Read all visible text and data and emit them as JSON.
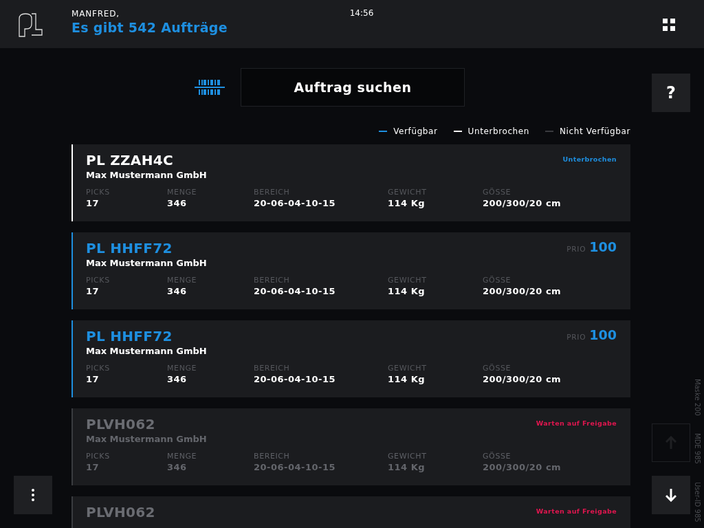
{
  "header": {
    "greeting": "MANFRED,",
    "title": "Es gibt 542 Aufträge",
    "time": "14:56"
  },
  "search": {
    "label": "Auftrag suchen"
  },
  "legend": [
    {
      "label": "Verfügbar",
      "color": "#1e8fe0"
    },
    {
      "label": "Unterbrochen",
      "color": "#ffffff"
    },
    {
      "label": "Nicht Verfügbar",
      "color": "#3a3b3f"
    }
  ],
  "orders": [
    {
      "kind": "interrupted",
      "title": "PL ZZAH4C",
      "company": "Max Mustermann GmbH",
      "status": "Unterbrochen",
      "fields": [
        {
          "label": "PICKS",
          "value": "17"
        },
        {
          "label": "MENGE",
          "value": "346"
        },
        {
          "label": "BEREICH",
          "value": "20-06-04-10-15"
        },
        {
          "label": "GEWICHT",
          "value": "114 Kg"
        },
        {
          "label": "GÖSSE",
          "value": "200/300/20 cm"
        }
      ]
    },
    {
      "kind": "available",
      "title": "PL HHFF72",
      "company": "Max Mustermann GmbH",
      "prio_label": "PRIO",
      "prio": "100",
      "fields": [
        {
          "label": "PICKS",
          "value": "17"
        },
        {
          "label": "MENGE",
          "value": "346"
        },
        {
          "label": "BEREICH",
          "value": "20-06-04-10-15"
        },
        {
          "label": "GEWICHT",
          "value": "114 Kg"
        },
        {
          "label": "GÖSSE",
          "value": "200/300/20 cm"
        }
      ]
    },
    {
      "kind": "available",
      "title": "PL HHFF72",
      "company": "Max Mustermann GmbH",
      "prio_label": "PRIO",
      "prio": "100",
      "fields": [
        {
          "label": "PICKS",
          "value": "17"
        },
        {
          "label": "MENGE",
          "value": "346"
        },
        {
          "label": "BEREICH",
          "value": "20-06-04-10-15"
        },
        {
          "label": "GEWICHT",
          "value": "114 Kg"
        },
        {
          "label": "GÖSSE",
          "value": "200/300/20 cm"
        }
      ]
    },
    {
      "kind": "unavailable",
      "title": "PLVH062",
      "company": "Max Mustermann GmbH",
      "status": "Warten auf Freigabe",
      "fields": [
        {
          "label": "PICKS",
          "value": "17"
        },
        {
          "label": "MENGE",
          "value": "346"
        },
        {
          "label": "BEREICH",
          "value": "20-06-04-10-15"
        },
        {
          "label": "GEWICHT",
          "value": "114 Kg"
        },
        {
          "label": "GÖSSE",
          "value": "200/300/20 cm"
        }
      ]
    },
    {
      "kind": "unavailable",
      "title": "PLVH062",
      "status": "Warten auf Freigabe"
    }
  ],
  "help": {
    "label": "?"
  },
  "scroll_up": {
    "disabled": true
  },
  "scroll_down": {
    "disabled": false
  },
  "side_info": [
    "Maske 200",
    "MDE 985",
    "User-ID 985"
  ]
}
